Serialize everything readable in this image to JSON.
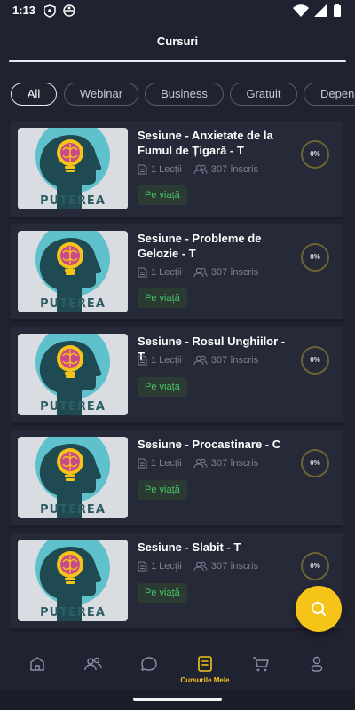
{
  "status_bar": {
    "time": "1:13"
  },
  "header": {
    "title": "Cursuri"
  },
  "filters": [
    {
      "label": "All",
      "active": true
    },
    {
      "label": "Webinar",
      "active": false
    },
    {
      "label": "Business",
      "active": false
    },
    {
      "label": "Gratuit",
      "active": false
    },
    {
      "label": "Depen",
      "active": false
    }
  ],
  "thumbnail_text": "PUTEREA",
  "courses": [
    {
      "title": "Sesiune - Anxietate de la Fumul de Țigară - T",
      "lessons": "1 Lecții",
      "enrolled": "307 înscris",
      "badge": "Pe viață",
      "progress": "0%"
    },
    {
      "title": "Sesiune - Probleme de Gelozie - T",
      "lessons": "1 Lecții",
      "enrolled": "307 înscris",
      "badge": "Pe viață",
      "progress": "0%"
    },
    {
      "title": "Sesiune - Rosul Unghiilor - T",
      "lessons": "1 Lecții",
      "enrolled": "307 înscris",
      "badge": "Pe viață",
      "progress": "0%"
    },
    {
      "title": "Sesiune - Procastinare - C",
      "lessons": "1 Lecții",
      "enrolled": "307 înscris",
      "badge": "Pe viață",
      "progress": "0%"
    },
    {
      "title": "Sesiune - Slabit - T",
      "lessons": "1 Lecții",
      "enrolled": "307 înscris",
      "badge": "Pe viață",
      "progress": "0%"
    }
  ],
  "bottom_nav": [
    {
      "icon": "home-icon",
      "label": "",
      "active": false
    },
    {
      "icon": "users-icon",
      "label": "",
      "active": false
    },
    {
      "icon": "chat-icon",
      "label": "",
      "active": false
    },
    {
      "icon": "my-courses-icon",
      "label": "Cursurile Mele",
      "active": true
    },
    {
      "icon": "cart-icon",
      "label": "",
      "active": false
    },
    {
      "icon": "profile-icon",
      "label": "",
      "active": false
    }
  ],
  "colors": {
    "background": "#20222f",
    "card": "#262938",
    "accent": "#f6c319",
    "badge_text": "#45c565",
    "badge_bg": "#2b3a32",
    "muted_text": "#7c8091"
  }
}
